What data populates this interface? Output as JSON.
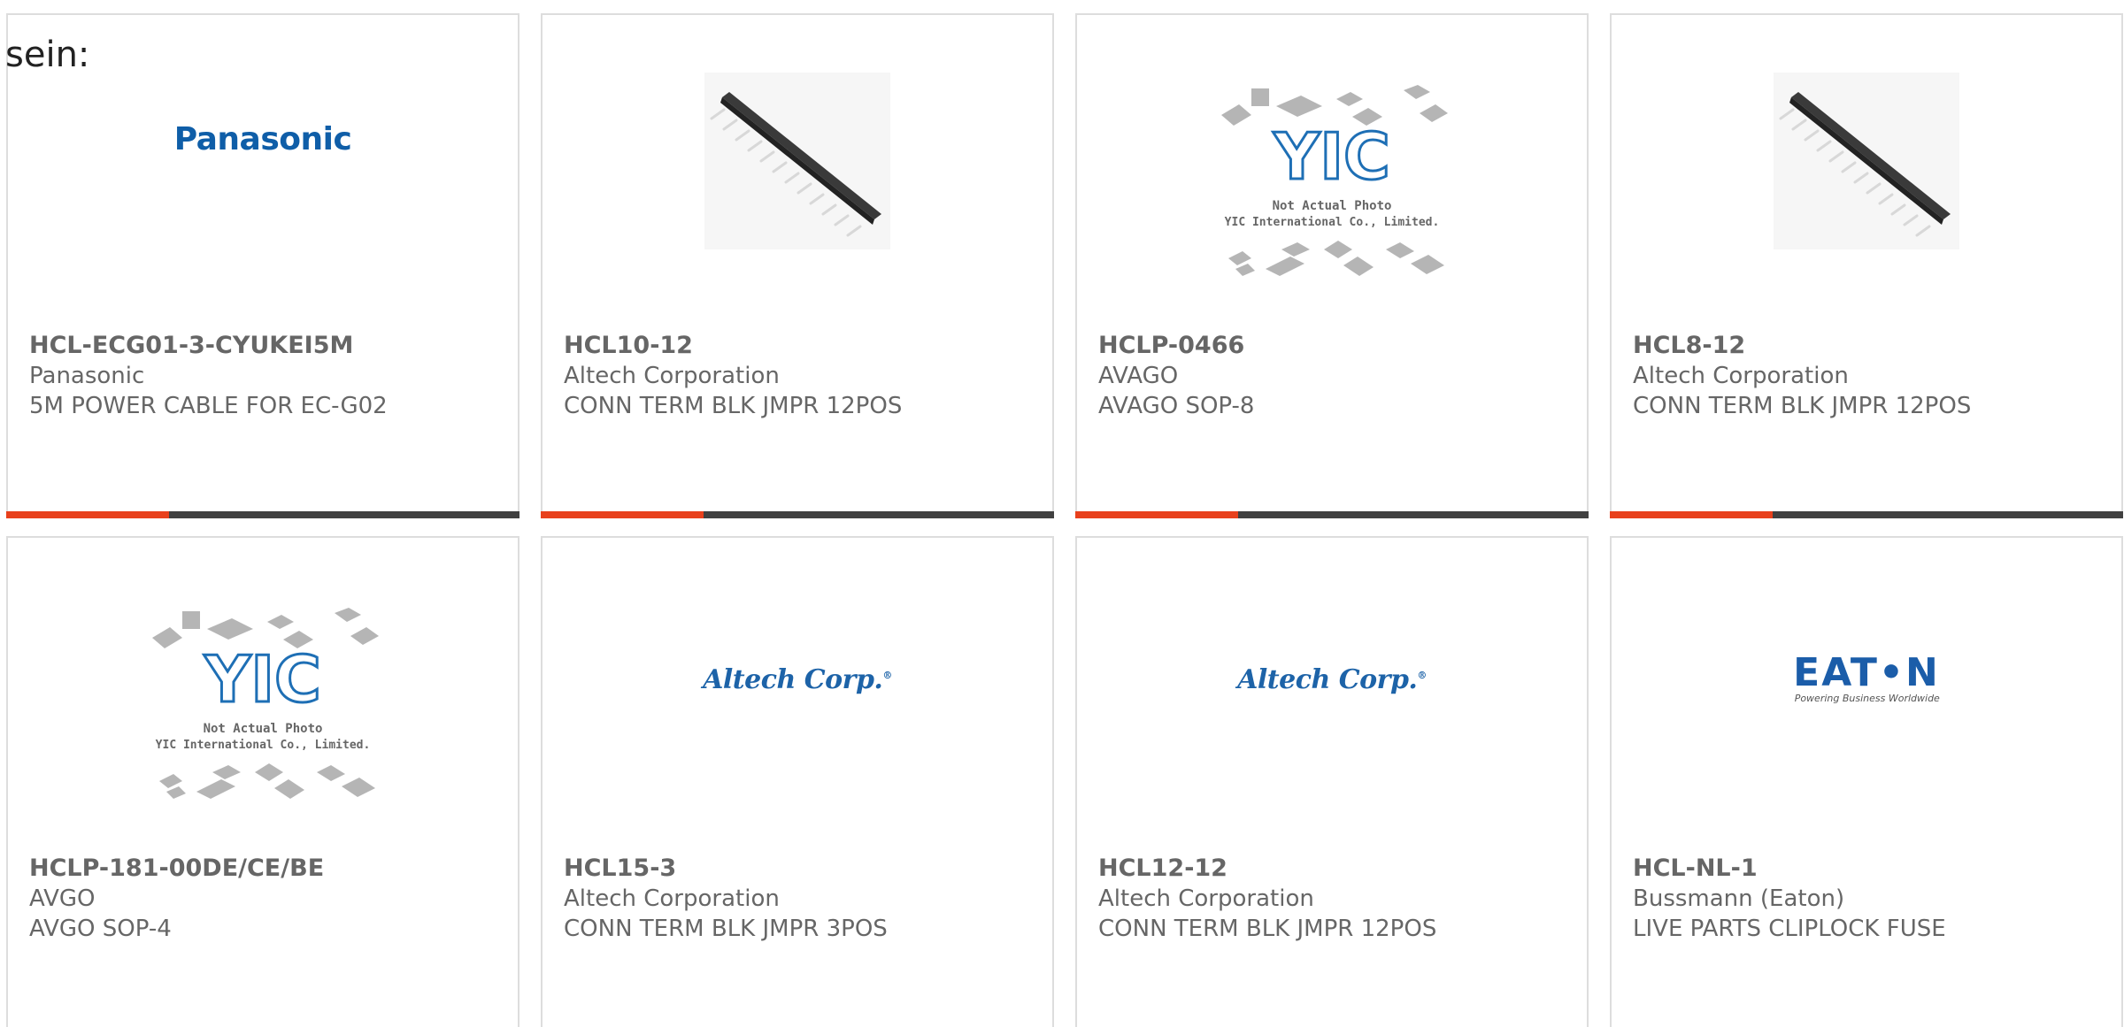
{
  "intro_text": "sein:",
  "colors": {
    "border": "#dddddd",
    "text": "#666666",
    "bar_dark": "#404040",
    "bar_accent": "#e8401c",
    "logo_blue": "#1d63a8"
  },
  "products": [
    {
      "part_number": "HCL-ECG01-3-CYUKEI5M",
      "manufacturer": "Panasonic",
      "description": "5M POWER CABLE FOR EC-G02",
      "image": "panasonic-logo",
      "logo_text": "Panasonic"
    },
    {
      "part_number": "HCL10-12",
      "manufacturer": "Altech Corporation",
      "description": "CONN TERM BLK JMPR 12POS",
      "image": "jumper-strip-photo"
    },
    {
      "part_number": "HCLP-0466",
      "manufacturer": "AVAGO",
      "description": "AVAGO SOP-8",
      "image": "yic-placeholder",
      "placeholder_lines": [
        "Not Actual Photo",
        "YIC International Co., Limited."
      ],
      "placeholder_logo": "YIC"
    },
    {
      "part_number": "HCL8-12",
      "manufacturer": "Altech Corporation",
      "description": "CONN TERM BLK JMPR 12POS",
      "image": "jumper-strip-photo"
    },
    {
      "part_number": "HCLP-181-00DE/CE/BE",
      "manufacturer": "AVGO",
      "description": "AVGO SOP-4",
      "image": "yic-placeholder",
      "placeholder_lines": [
        "Not Actual Photo",
        "YIC International Co., Limited."
      ],
      "placeholder_logo": "YIC"
    },
    {
      "part_number": "HCL15-3",
      "manufacturer": "Altech Corporation",
      "description": "CONN TERM BLK JMPR 3POS",
      "image": "altech-logo",
      "logo_text": "Altech Corp."
    },
    {
      "part_number": "HCL12-12",
      "manufacturer": "Altech Corporation",
      "description": "CONN TERM BLK JMPR 12POS",
      "image": "altech-logo",
      "logo_text": "Altech Corp."
    },
    {
      "part_number": "HCL-NL-1",
      "manufacturer": "Bussmann (Eaton)",
      "description": "LIVE PARTS CLIPLOCK FUSE",
      "image": "eaton-logo",
      "logo_text": "EAT•N",
      "logo_tagline": "Powering Business Worldwide"
    }
  ]
}
